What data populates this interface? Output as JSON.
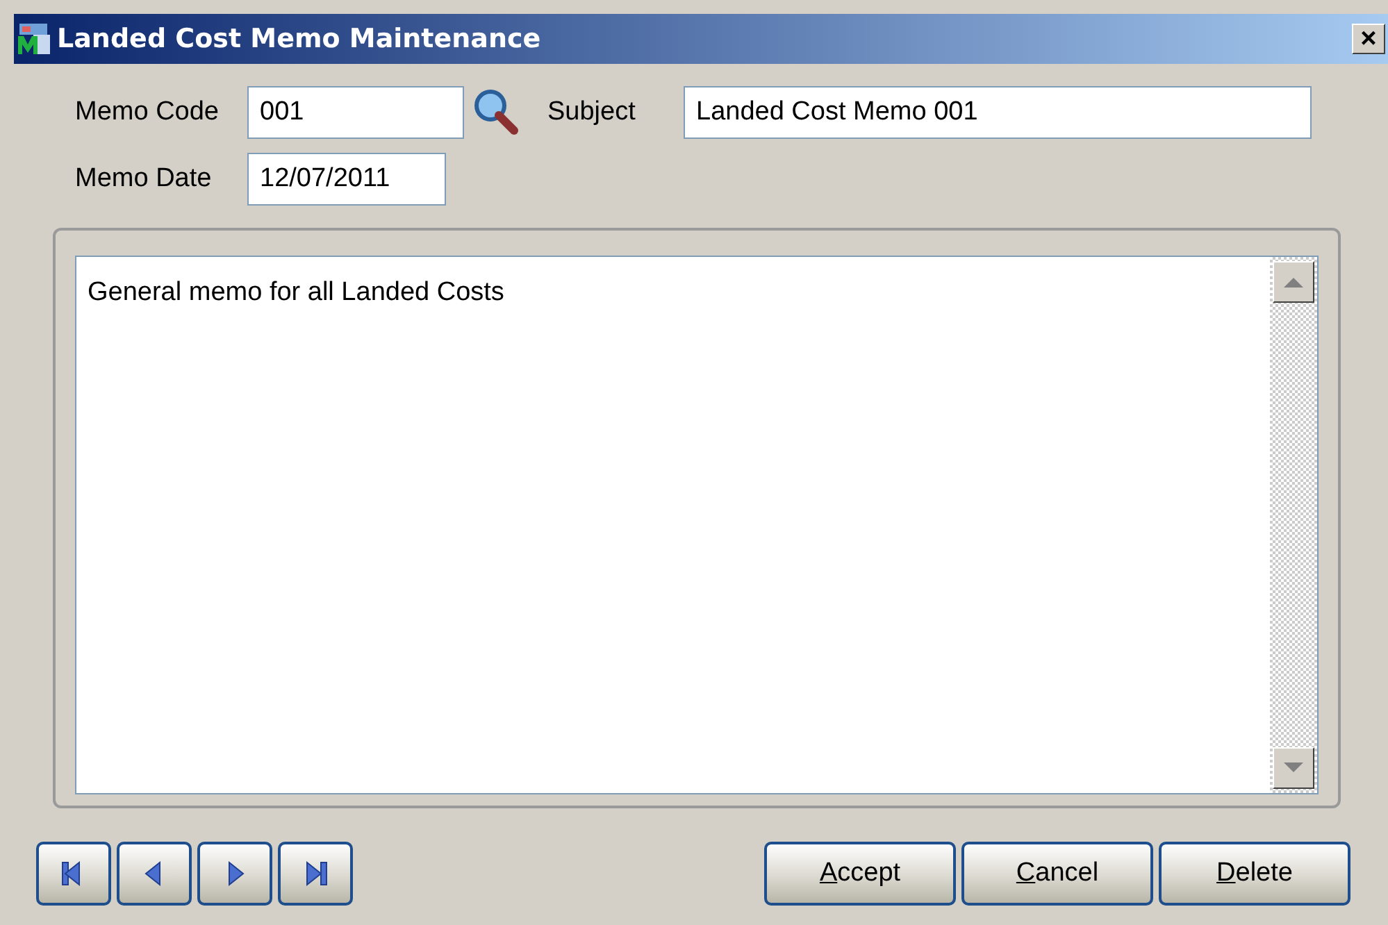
{
  "window": {
    "title": "Landed Cost Memo Maintenance",
    "close": "×"
  },
  "fields": {
    "memo_code": {
      "label": "Memo Code",
      "value": "001"
    },
    "subject": {
      "label": "Subject",
      "value": "Landed Cost Memo 001"
    },
    "memo_date": {
      "label": "Memo Date",
      "value": "12/07/2011"
    }
  },
  "memo_text": "General memo for all Landed Costs",
  "nav_buttons": [
    {
      "kind": "first"
    },
    {
      "kind": "previous"
    },
    {
      "kind": "next"
    },
    {
      "kind": "last"
    }
  ],
  "buttons": [
    {
      "label": "Accept",
      "first_letter_underlined": true
    },
    {
      "label": "Cancel",
      "first_letter_underlined": true
    },
    {
      "label": "Delete",
      "first_letter_underlined": true
    }
  ]
}
